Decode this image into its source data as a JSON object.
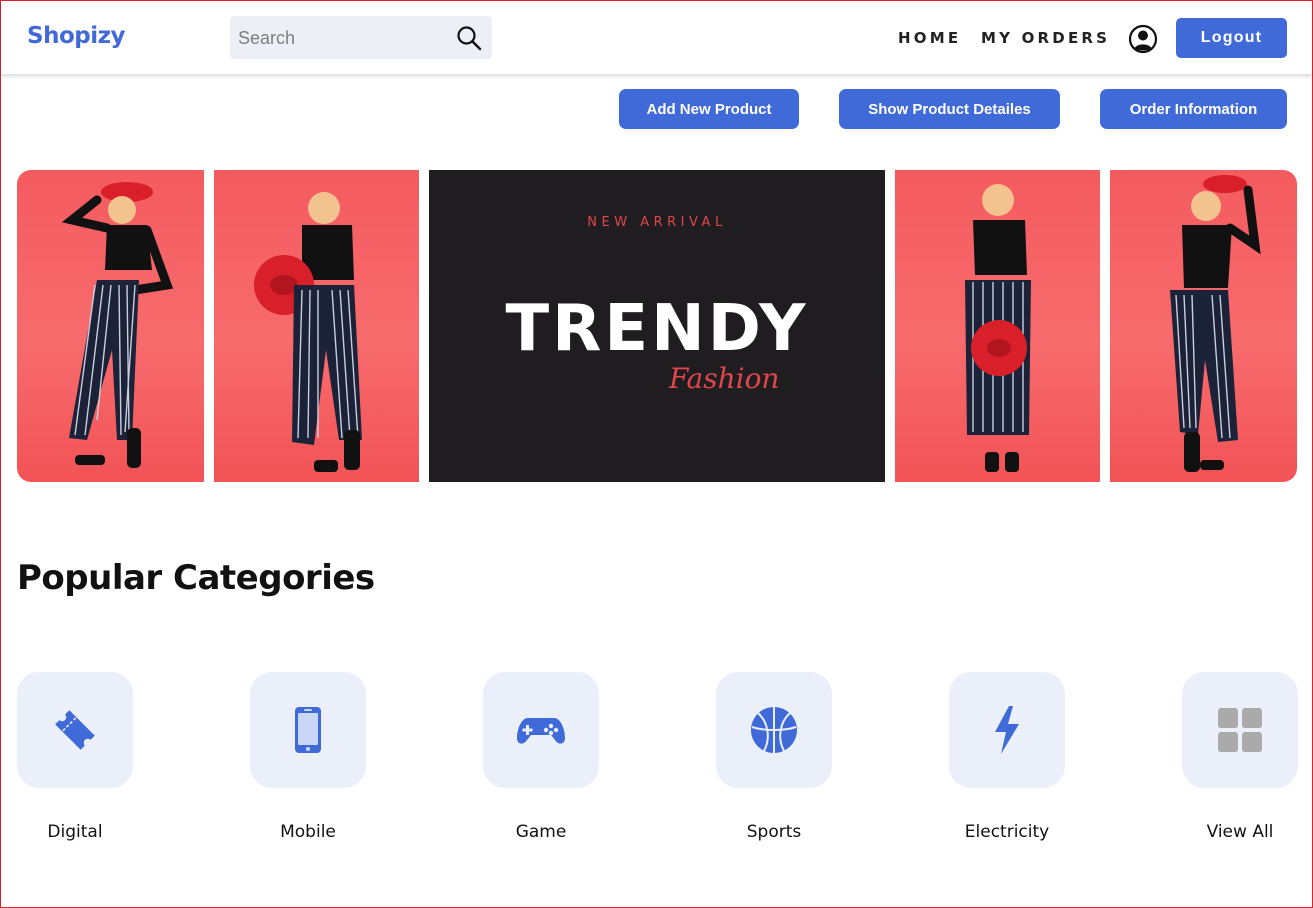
{
  "brand": "Shopizy",
  "search": {
    "placeholder": "Search"
  },
  "nav": {
    "home": "HOME",
    "orders": "MY ORDERS",
    "logout": "Logout"
  },
  "actions": {
    "add_product": "Add New Product",
    "show_details": "Show Product Detailes",
    "order_info": "Order Information"
  },
  "banner": {
    "kicker": "NEW ARRIVAL",
    "headline": "TRENDY",
    "script": "Fashion"
  },
  "categories": {
    "title": "Popular Categories",
    "items": [
      {
        "label": "Digital",
        "icon": "ticket-icon"
      },
      {
        "label": "Mobile",
        "icon": "mobile-icon"
      },
      {
        "label": "Game",
        "icon": "gamepad-icon"
      },
      {
        "label": "Sports",
        "icon": "basketball-icon"
      },
      {
        "label": "Electricity",
        "icon": "bolt-icon"
      },
      {
        "label": "View All",
        "icon": "grid-icon"
      }
    ]
  },
  "colors": {
    "accent": "#3f6ad8",
    "tile": "#eaeffa",
    "banner_dark": "#1f1d20",
    "banner_red": "#e0464c"
  }
}
